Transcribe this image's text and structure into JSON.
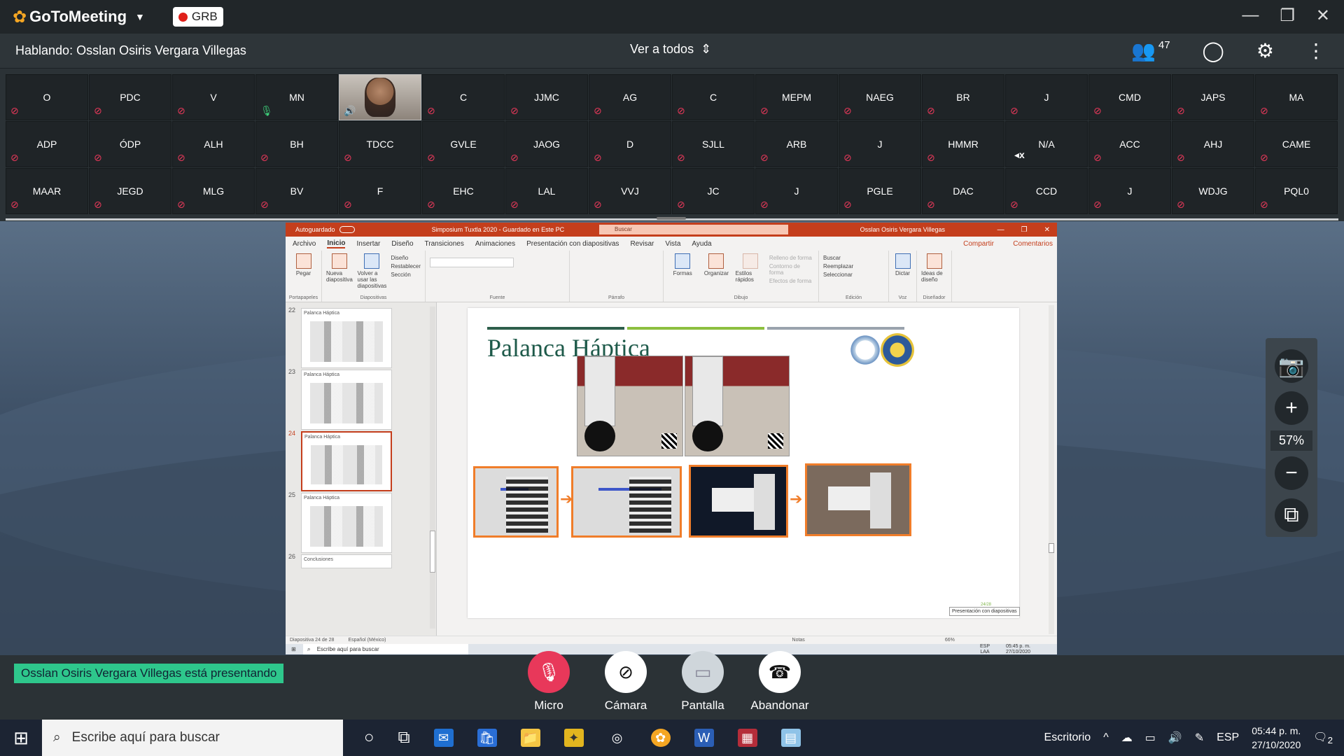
{
  "app": {
    "name": "GoToMeeting",
    "rec_label": "GRB"
  },
  "header": {
    "speaking": "Hablando: Osslan Osiris Vergara Villegas",
    "view_all": "Ver a todos",
    "participant_count": "47"
  },
  "participants": [
    [
      "O",
      "PDC",
      "V",
      "MN",
      "",
      "C",
      "JJMC",
      "AG",
      "C",
      "MEPM",
      "NAEG",
      "BR",
      "J",
      "CMD",
      "JAPS",
      "MA"
    ],
    [
      "ADP",
      "ÓDP",
      "ALH",
      "BH",
      "TDCC",
      "GVLE",
      "JAOG",
      "D",
      "SJLL",
      "ARB",
      "J",
      "HMMR",
      "N/A",
      "ACC",
      "AHJ",
      "CAME"
    ],
    [
      "MAAR",
      "JEGD",
      "MLG",
      "BV",
      "F",
      "EHC",
      "LAL",
      "VVJ",
      "JC",
      "J",
      "PGLE",
      "DAC",
      "CCD",
      "J",
      "WDJG",
      "PQL0"
    ]
  ],
  "ppt": {
    "autosave": "Autoguardado",
    "doc_title": "Simposium Tuxtla 2020  -  Guardado en Este PC",
    "search": "Buscar",
    "user": "Osslan Osiris Vergara Villegas",
    "menu": [
      "Archivo",
      "Inicio",
      "Insertar",
      "Diseño",
      "Transiciones",
      "Animaciones",
      "Presentación con diapositivas",
      "Revisar",
      "Vista",
      "Ayuda"
    ],
    "share": "Compartir",
    "comments": "Comentarios",
    "ribbon": {
      "pegar": "Pegar",
      "portapapeles": "Portapapeles",
      "nueva": "Nueva diapositiva",
      "volver": "Volver a usar las diapositivas",
      "diseno": "Diseño",
      "restablecer": "Restablecer",
      "seccion": "Sección",
      "diapositivas": "Diapositivas",
      "fuente": "Fuente",
      "parrafo": "Párrafo",
      "formas": "Formas",
      "organizar": "Organizar",
      "estilos": "Estilos rápidos",
      "relleno": "Relleno de forma",
      "contorno": "Contorno de forma",
      "efectos": "Efectos de forma",
      "dibujo": "Dibujo",
      "buscar": "Buscar",
      "reemplazar": "Reemplazar",
      "seleccionar": "Seleccionar",
      "edicion": "Edición",
      "dictar": "Dictar",
      "voz": "Voz",
      "ideas": "Ideas de diseño",
      "disenador": "Diseñador"
    },
    "thumbs": [
      {
        "num": "22",
        "title": "Palanca Háptica"
      },
      {
        "num": "23",
        "title": "Palanca Háptica"
      },
      {
        "num": "24",
        "title": "Palanca Háptica"
      },
      {
        "num": "25",
        "title": "Palanca Háptica"
      },
      {
        "num": "26",
        "title": "Conclusiones"
      }
    ],
    "slide_title": "Palanca Háptica",
    "slide_page": "24/28",
    "tooltip": "Presentación con diapositivas",
    "status_left": "Diapositiva 24 de 28",
    "status_lang": "Español (México)",
    "status_notes": "Notas",
    "status_zoom": "66%",
    "inner_search": "Escribe aquí para buscar",
    "inner_lang": "ESP\nLAA",
    "inner_clock": "05:45 p. m.\n27/10/2020"
  },
  "zoom": {
    "percent": "57%"
  },
  "presenting": "Osslan Osiris Vergara Villegas está presentando",
  "controls": {
    "micro": "Micro",
    "camera": "Cámara",
    "screen": "Pantalla",
    "leave": "Abandonar"
  },
  "taskbar": {
    "search": "Escribe aquí para buscar",
    "desktop": "Escritorio",
    "lang": "ESP",
    "time": "05:44 p. m.",
    "date": "27/10/2020",
    "notif": "2"
  },
  "colors": {
    "accent_red": "#e8385a",
    "ppt_red": "#c43e1c",
    "presenting_green": "#2ec78c",
    "slide_orange": "#f07d2a"
  }
}
